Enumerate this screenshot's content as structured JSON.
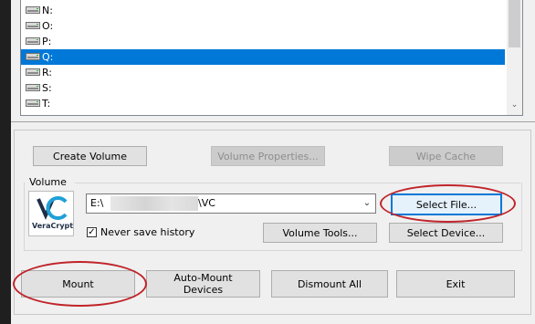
{
  "drives": [
    {
      "label": "N:",
      "selected": false
    },
    {
      "label": "O:",
      "selected": false
    },
    {
      "label": "P:",
      "selected": false
    },
    {
      "label": "Q:",
      "selected": true
    },
    {
      "label": "R:",
      "selected": false
    },
    {
      "label": "S:",
      "selected": false
    },
    {
      "label": "T:",
      "selected": false
    }
  ],
  "buttons": {
    "create_volume": "Create Volume",
    "volume_properties": "Volume Properties...",
    "wipe_cache": "Wipe Cache",
    "select_file": "Select File...",
    "volume_tools": "Volume Tools...",
    "select_device": "Select Device...",
    "mount": "Mount",
    "auto_mount": "Auto-Mount Devices",
    "dismount_all": "Dismount All",
    "exit": "Exit"
  },
  "volume": {
    "group_label": "Volume",
    "path_prefix": "E:\\",
    "path_suffix": "\\VC",
    "never_save_history_label": "Never save history",
    "never_save_history_checked": true,
    "logo_text": "VeraCrypt"
  },
  "colors": {
    "selection": "#0078d7",
    "highlight_circle": "#c0242a",
    "logo_accent": "#1fa0d8"
  }
}
